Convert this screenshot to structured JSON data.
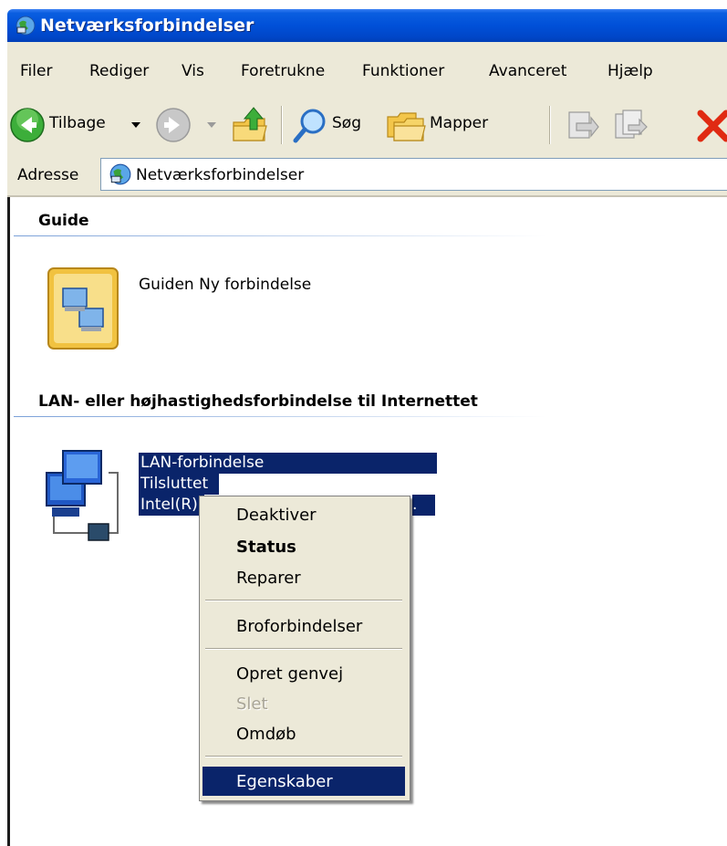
{
  "window": {
    "title": "Netværksforbindelser"
  },
  "menu": [
    "Filer",
    "Rediger",
    "Vis",
    "Foretrukne",
    "Funktioner",
    "Avanceret",
    "Hjælp"
  ],
  "toolbar": {
    "back_label": "Tilbage",
    "search_label": "Søg",
    "folders_label": "Mapper"
  },
  "address": {
    "label": "Adresse",
    "value": "Netværksforbindelser"
  },
  "groups": {
    "guide": {
      "heading": "Guide",
      "item": "Guiden Ny forbindelse"
    },
    "lan": {
      "heading": "LAN- eller højhastighedsforbindelse til Internettet",
      "name": "LAN-forbindelse",
      "status": "Tilsluttet",
      "device": "Intel(R)",
      "device_trail": "."
    }
  },
  "context_menu": {
    "items": [
      "Deaktiver",
      "Status",
      "Reparer",
      "Broforbindelser",
      "Opret genvej",
      "Slet",
      "Omdøb",
      "Egenskaber"
    ],
    "default_item": "Status",
    "disabled_item": "Slet",
    "highlighted_item": "Egenskaber"
  },
  "colors": {
    "titlebar": "#0050d8",
    "chrome": "#ece9d8",
    "selection": "#0a246a"
  }
}
